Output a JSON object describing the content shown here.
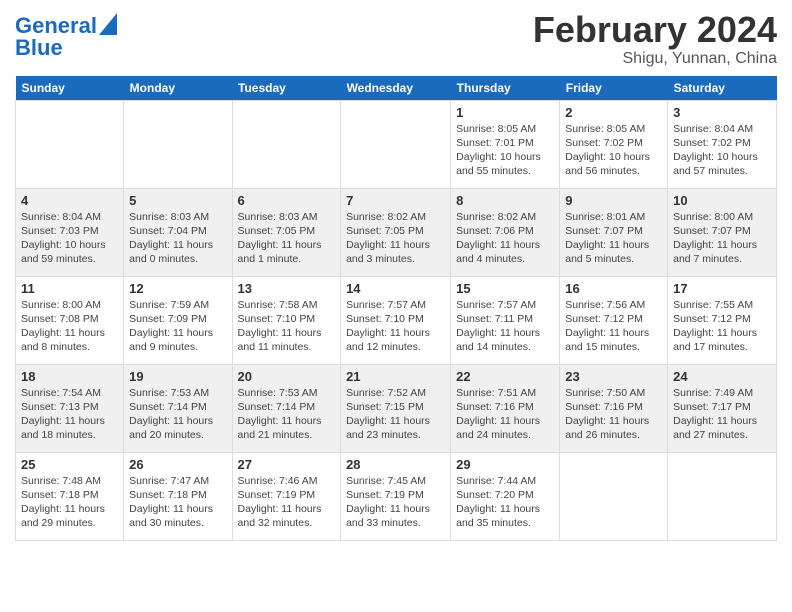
{
  "header": {
    "logo_line1": "General",
    "logo_line2": "Blue",
    "month": "February 2024",
    "location": "Shigu, Yunnan, China"
  },
  "days_of_week": [
    "Sunday",
    "Monday",
    "Tuesday",
    "Wednesday",
    "Thursday",
    "Friday",
    "Saturday"
  ],
  "weeks": [
    [
      {
        "day": "",
        "info": ""
      },
      {
        "day": "",
        "info": ""
      },
      {
        "day": "",
        "info": ""
      },
      {
        "day": "",
        "info": ""
      },
      {
        "day": "1",
        "info": "Sunrise: 8:05 AM\nSunset: 7:01 PM\nDaylight: 10 hours and 55 minutes."
      },
      {
        "day": "2",
        "info": "Sunrise: 8:05 AM\nSunset: 7:02 PM\nDaylight: 10 hours and 56 minutes."
      },
      {
        "day": "3",
        "info": "Sunrise: 8:04 AM\nSunset: 7:02 PM\nDaylight: 10 hours and 57 minutes."
      }
    ],
    [
      {
        "day": "4",
        "info": "Sunrise: 8:04 AM\nSunset: 7:03 PM\nDaylight: 10 hours and 59 minutes."
      },
      {
        "day": "5",
        "info": "Sunrise: 8:03 AM\nSunset: 7:04 PM\nDaylight: 11 hours and 0 minutes."
      },
      {
        "day": "6",
        "info": "Sunrise: 8:03 AM\nSunset: 7:05 PM\nDaylight: 11 hours and 1 minute."
      },
      {
        "day": "7",
        "info": "Sunrise: 8:02 AM\nSunset: 7:05 PM\nDaylight: 11 hours and 3 minutes."
      },
      {
        "day": "8",
        "info": "Sunrise: 8:02 AM\nSunset: 7:06 PM\nDaylight: 11 hours and 4 minutes."
      },
      {
        "day": "9",
        "info": "Sunrise: 8:01 AM\nSunset: 7:07 PM\nDaylight: 11 hours and 5 minutes."
      },
      {
        "day": "10",
        "info": "Sunrise: 8:00 AM\nSunset: 7:07 PM\nDaylight: 11 hours and 7 minutes."
      }
    ],
    [
      {
        "day": "11",
        "info": "Sunrise: 8:00 AM\nSunset: 7:08 PM\nDaylight: 11 hours and 8 minutes."
      },
      {
        "day": "12",
        "info": "Sunrise: 7:59 AM\nSunset: 7:09 PM\nDaylight: 11 hours and 9 minutes."
      },
      {
        "day": "13",
        "info": "Sunrise: 7:58 AM\nSunset: 7:10 PM\nDaylight: 11 hours and 11 minutes."
      },
      {
        "day": "14",
        "info": "Sunrise: 7:57 AM\nSunset: 7:10 PM\nDaylight: 11 hours and 12 minutes."
      },
      {
        "day": "15",
        "info": "Sunrise: 7:57 AM\nSunset: 7:11 PM\nDaylight: 11 hours and 14 minutes."
      },
      {
        "day": "16",
        "info": "Sunrise: 7:56 AM\nSunset: 7:12 PM\nDaylight: 11 hours and 15 minutes."
      },
      {
        "day": "17",
        "info": "Sunrise: 7:55 AM\nSunset: 7:12 PM\nDaylight: 11 hours and 17 minutes."
      }
    ],
    [
      {
        "day": "18",
        "info": "Sunrise: 7:54 AM\nSunset: 7:13 PM\nDaylight: 11 hours and 18 minutes."
      },
      {
        "day": "19",
        "info": "Sunrise: 7:53 AM\nSunset: 7:14 PM\nDaylight: 11 hours and 20 minutes."
      },
      {
        "day": "20",
        "info": "Sunrise: 7:53 AM\nSunset: 7:14 PM\nDaylight: 11 hours and 21 minutes."
      },
      {
        "day": "21",
        "info": "Sunrise: 7:52 AM\nSunset: 7:15 PM\nDaylight: 11 hours and 23 minutes."
      },
      {
        "day": "22",
        "info": "Sunrise: 7:51 AM\nSunset: 7:16 PM\nDaylight: 11 hours and 24 minutes."
      },
      {
        "day": "23",
        "info": "Sunrise: 7:50 AM\nSunset: 7:16 PM\nDaylight: 11 hours and 26 minutes."
      },
      {
        "day": "24",
        "info": "Sunrise: 7:49 AM\nSunset: 7:17 PM\nDaylight: 11 hours and 27 minutes."
      }
    ],
    [
      {
        "day": "25",
        "info": "Sunrise: 7:48 AM\nSunset: 7:18 PM\nDaylight: 11 hours and 29 minutes."
      },
      {
        "day": "26",
        "info": "Sunrise: 7:47 AM\nSunset: 7:18 PM\nDaylight: 11 hours and 30 minutes."
      },
      {
        "day": "27",
        "info": "Sunrise: 7:46 AM\nSunset: 7:19 PM\nDaylight: 11 hours and 32 minutes."
      },
      {
        "day": "28",
        "info": "Sunrise: 7:45 AM\nSunset: 7:19 PM\nDaylight: 11 hours and 33 minutes."
      },
      {
        "day": "29",
        "info": "Sunrise: 7:44 AM\nSunset: 7:20 PM\nDaylight: 11 hours and 35 minutes."
      },
      {
        "day": "",
        "info": ""
      },
      {
        "day": "",
        "info": ""
      }
    ]
  ]
}
